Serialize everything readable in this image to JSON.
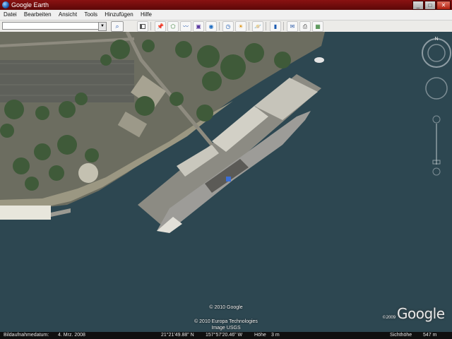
{
  "window": {
    "title": "Google Earth",
    "buttons": {
      "minimize": "_",
      "maximize": "□",
      "close": "✕"
    }
  },
  "menu": {
    "items": [
      {
        "label": "Datei"
      },
      {
        "label": "Bearbeiten"
      },
      {
        "label": "Ansicht"
      },
      {
        "label": "Tools"
      },
      {
        "label": "Hinzufügen"
      },
      {
        "label": "Hilfe"
      }
    ]
  },
  "toolbar": {
    "search_value": "",
    "icons": [
      "sidebar-toggle-icon",
      "placemark-icon",
      "polygon-icon",
      "path-icon",
      "image-overlay-icon",
      "record-tour-icon",
      "historical-imagery-icon",
      "sunlight-icon",
      "planets-icon",
      "ruler-icon",
      "email-icon",
      "print-icon",
      "view-in-maps-icon"
    ]
  },
  "map": {
    "credits": {
      "line1": "© 2010 Google",
      "line2": "© 2010 Europa Technologies",
      "line3": "Image USGS"
    },
    "logo": {
      "text": "Google",
      "year": "©2009"
    }
  },
  "status": {
    "imagery_label": "Bildaufnahmedatum:",
    "imagery_date": "4. Mrz. 2008",
    "latitude": "21°21'49.88\" N",
    "longitude": "157°57'20.46\" W",
    "elevation_label": "Höhe",
    "elevation": "3 m",
    "eye_alt_label": "Sichthöhe",
    "eye_alt": "547 m"
  },
  "colors": {
    "water": "#2c4650",
    "titlebar": "#7a0e0e",
    "land": "#6f6f62"
  }
}
